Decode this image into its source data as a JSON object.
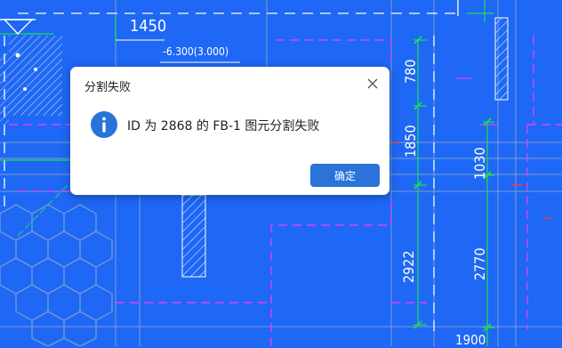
{
  "drawing": {
    "dimensions": {
      "d1450": "1450",
      "level": "-6.300(3.000)",
      "d780": "780",
      "d1850": "1850",
      "d2922": "2922",
      "d1030": "1030",
      "d2770": "2770",
      "d1900": "1900"
    }
  },
  "dialog": {
    "title": "分割失败",
    "message": "ID 为 2868 的 FB-1 图元分割失败",
    "ok_label": "确定",
    "icon": "info-icon",
    "close_icon": "close-icon"
  },
  "colors": {
    "background": "#1e68f5",
    "accent": "#2a73d8"
  }
}
